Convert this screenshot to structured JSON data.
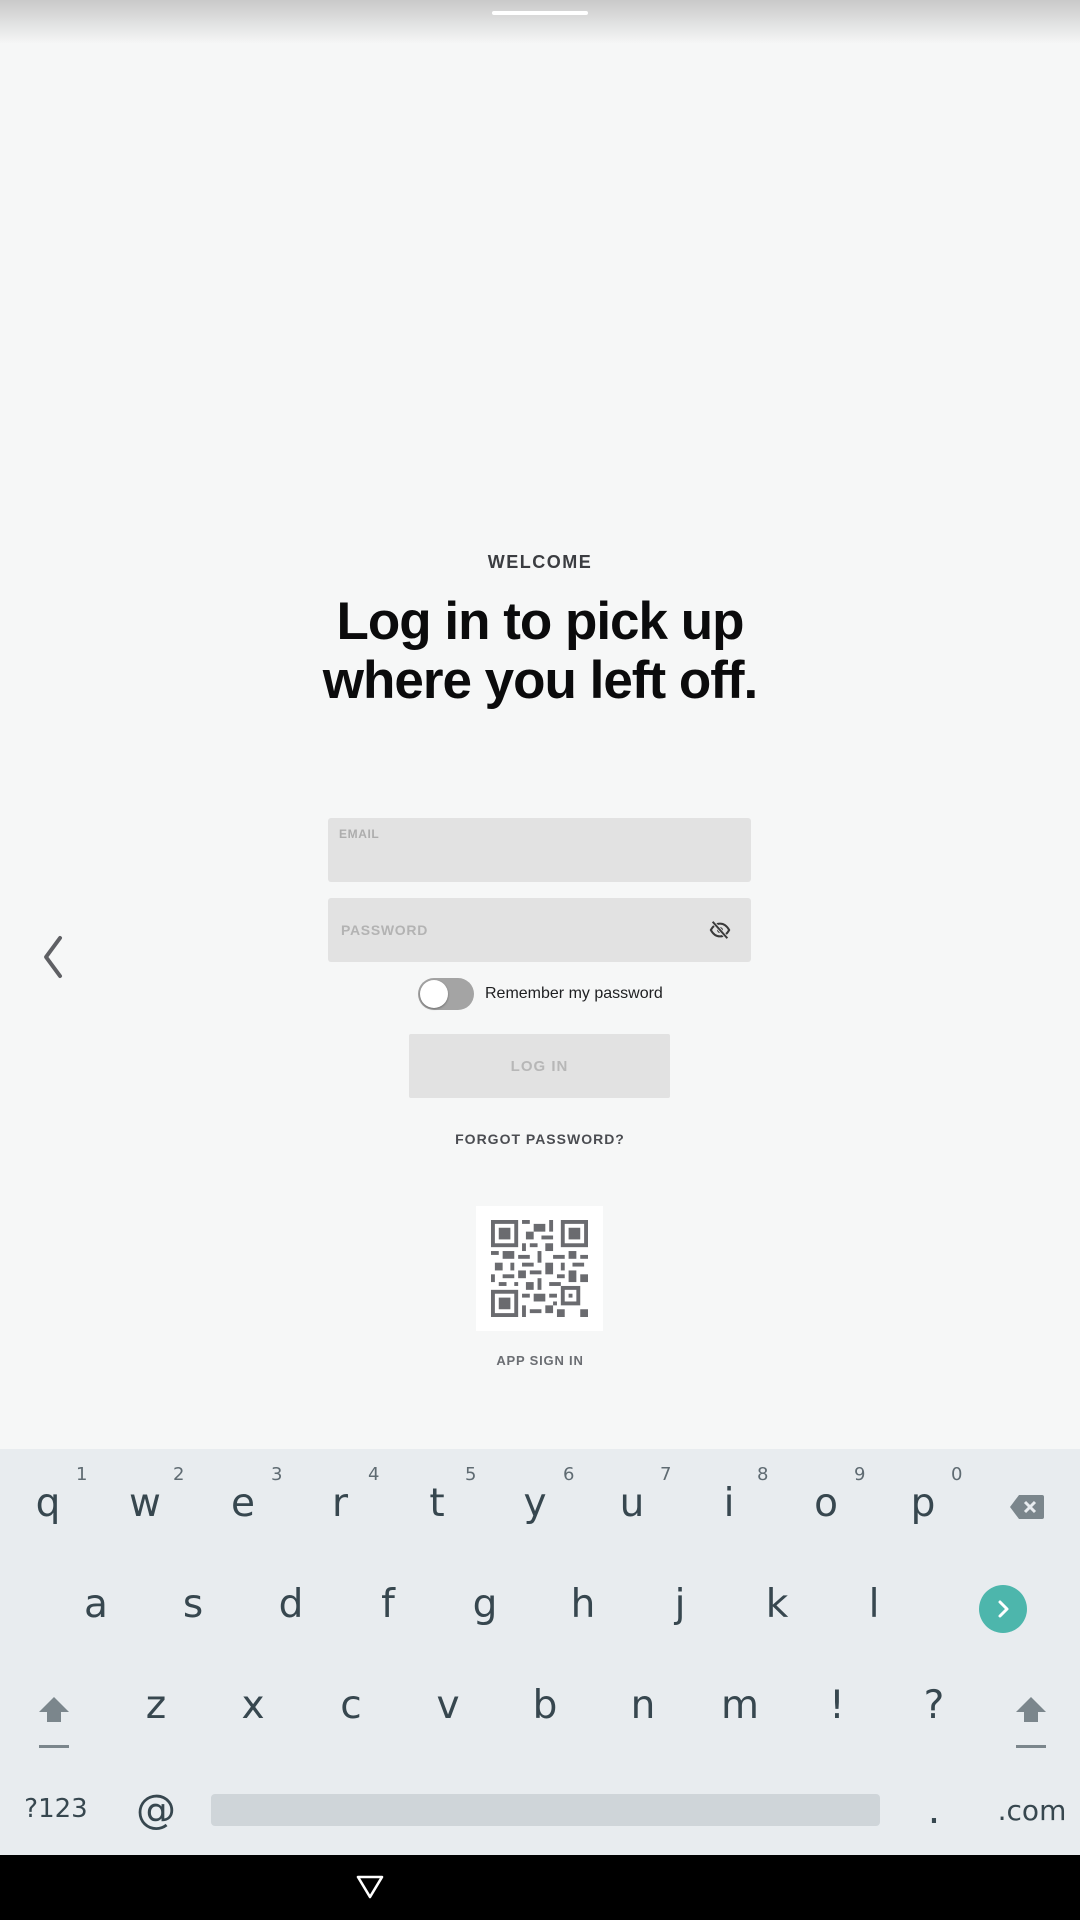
{
  "header": {
    "eyebrow": "WELCOME",
    "headline_line1": "Log in to pick up",
    "headline_line2": "where you left off."
  },
  "form": {
    "email_label": "EMAIL",
    "email_value": "",
    "password_placeholder": "PASSWORD",
    "password_value": "",
    "remember_label": "Remember my password",
    "remember_checked": false,
    "login_label": "LOG IN",
    "forgot_label": "FORGOT PASSWORD?"
  },
  "qr": {
    "caption": "APP SIGN IN"
  },
  "keyboard": {
    "row1": [
      "q",
      "w",
      "e",
      "r",
      "t",
      "y",
      "u",
      "i",
      "o",
      "p"
    ],
    "row1_hints": [
      "1",
      "2",
      "3",
      "4",
      "5",
      "6",
      "7",
      "8",
      "9",
      "0"
    ],
    "row2": [
      "a",
      "s",
      "d",
      "f",
      "g",
      "h",
      "j",
      "k",
      "l"
    ],
    "row3": [
      "z",
      "x",
      "c",
      "v",
      "b",
      "n",
      "m",
      "!",
      "?"
    ],
    "symbols_label": "?123",
    "at_label": "@",
    "period_label": ".",
    "dotcom_label": ".com"
  },
  "colors": {
    "background": "#f6f7f7",
    "go_key": "#4db6ac",
    "toggle_off": "#a4a4a4"
  }
}
